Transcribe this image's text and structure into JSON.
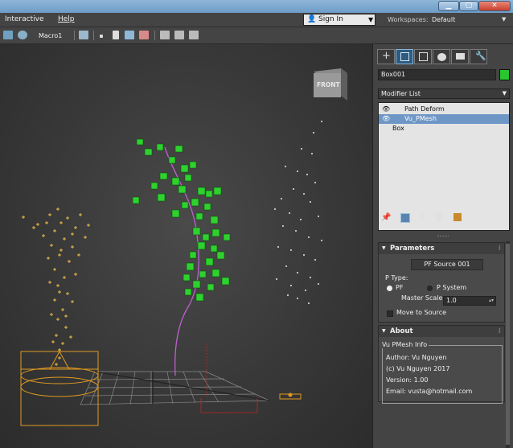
{
  "menubar": {
    "items": [
      "Interactive",
      "Help"
    ]
  },
  "signin": {
    "label": "Sign In"
  },
  "workspaces": {
    "label": "Workspaces:",
    "value": "Default"
  },
  "toolbar": {
    "macro_label": "Macro1"
  },
  "viewport": {
    "viewcube_label": "FRONT"
  },
  "panel": {
    "object_name": "Box001",
    "object_color": "#29c62f",
    "modifier_list_label": "Modifier List",
    "stack": [
      "Path Deform",
      "Vu_PMesh",
      "Box"
    ],
    "selected_stack_index": 1,
    "parameters": {
      "title": "Parameters",
      "pf_source_button": "PF Source 001",
      "ptype_label": "P Type:",
      "ptype_options": [
        "PF",
        "P System"
      ],
      "ptype_selected": "PF",
      "master_scale_label": "Master Scale",
      "master_scale_value": "1.0",
      "move_to_source_label": "Move to Source"
    },
    "about": {
      "title": "About",
      "group_title": "Vu PMesh Info",
      "lines": [
        "Author: Vu Nguyen",
        "(c) Vu Nguyen 2017",
        "Version: 1.00",
        "Email: vusta@hotmail.com"
      ]
    }
  },
  "colors": {
    "accent": "#6f97c6",
    "cube_green": "#2fd12f",
    "particle_yellow": "#f2c048",
    "path_magenta": "#c060d0",
    "spring_orange": "#e09a20"
  }
}
